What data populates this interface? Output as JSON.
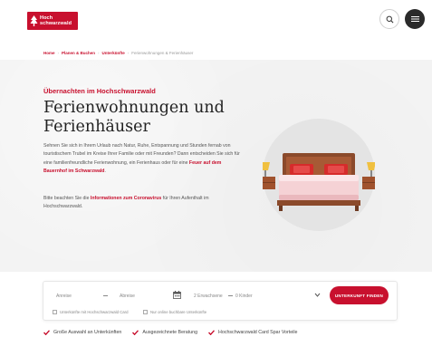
{
  "header": {
    "logo_line1": "Hoch",
    "logo_line2": "schwarzwald",
    "search_icon": "search-icon",
    "menu_icon": "hamburger-menu-icon"
  },
  "breadcrumb": {
    "items": [
      "Home",
      "Planen & Buchen",
      "Unterkünfte",
      "Ferienwohnungen & Ferienhäuser"
    ]
  },
  "hero": {
    "eyebrow": "Übernachten im Hochschwarzwald",
    "title": "Ferienwohnungen und Ferienhäuser",
    "p1_text": "Sehnen Sie sich in Ihrem Urlaub nach Natur, Ruhe, Entspannung und Stunden fernab von touristischem Trubel im Kreise Ihrer Familie oder mit Freunden? Dann entscheiden Sie sich für eine familienfreundliche Ferienwohnung, ein Ferienhaus oder für eine ",
    "p1_link": "Feuer auf dem Bauernhof im Schwarzwald",
    "p1_end": ".",
    "p2_start": "Bitte beachten Sie die ",
    "p2_link": "Informationen zum Coronavirus",
    "p2_end": " für Ihren Aufenthalt im Hochschwarzwald.",
    "illustration": "bedroom-illustration"
  },
  "search": {
    "arrival": "Anreise",
    "departure": "Abreise",
    "adults": "2 Erwachsene",
    "children": "0 Kinder",
    "cta": "UNTERKUNFT FINDEN",
    "check1": "Unterkünfte mit Hochschwarzwald Card",
    "check2": "Nur online buchbare Unterkünfte",
    "calendar_icon": "calendar-icon",
    "chevron_icon": "chevron-down-icon"
  },
  "usps": [
    "Große Auswahl an Unterkünften",
    "Ausgezeichnete Beratung",
    "Hochschwarzwald Card Spar Vorteile"
  ],
  "colors": {
    "brand": "#c8102e",
    "dark": "#2b2b2b",
    "hero_bg": "#f3f3f3"
  }
}
